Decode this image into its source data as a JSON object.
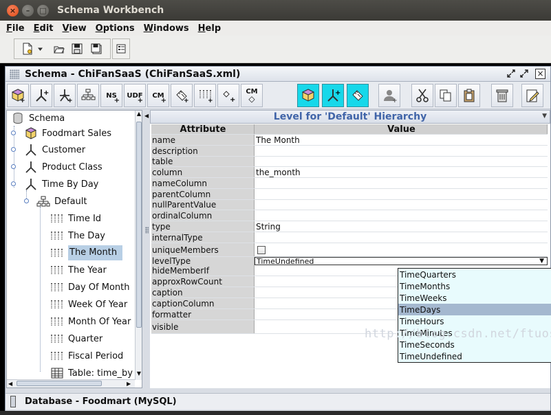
{
  "window": {
    "title": "Schema Workbench"
  },
  "menus": [
    "File",
    "Edit",
    "View",
    "Options",
    "Windows",
    "Help"
  ],
  "menu_mnemonics": [
    "F",
    "E",
    "V",
    "O",
    "W",
    "H"
  ],
  "frame": {
    "title": "Schema - ChiFanSaaS (ChiFanSaaS.xml)"
  },
  "toolbar": {
    "buttons": [
      {
        "icon": "cube-icon",
        "label": ""
      },
      {
        "icon": "dimension-icon",
        "label": ""
      },
      {
        "icon": "dimension-usage-icon",
        "label": ""
      },
      {
        "icon": "hierarchy-icon",
        "label": ""
      },
      {
        "icon": "named-set-icon",
        "label": "NS"
      },
      {
        "icon": "udf-icon",
        "label": "UDF"
      },
      {
        "icon": "calculated-member-icon",
        "label": "CM"
      },
      {
        "icon": "measure-icon",
        "label": ""
      },
      {
        "icon": "level-icon",
        "label": ""
      },
      {
        "icon": "property-icon",
        "label": ""
      },
      {
        "icon": "calculated-member-property-icon",
        "label": "CM"
      },
      {
        "icon": "virtual-cube-icon",
        "label": ""
      },
      {
        "icon": "virtual-dimension-icon",
        "label": ""
      },
      {
        "icon": "virtual-measure-icon",
        "label": ""
      },
      {
        "icon": "role-icon",
        "label": ""
      },
      {
        "icon": "cut-icon",
        "label": ""
      },
      {
        "icon": "copy-icon",
        "label": ""
      },
      {
        "icon": "paste-icon",
        "label": ""
      },
      {
        "icon": "delete-icon",
        "label": ""
      },
      {
        "icon": "edit-icon",
        "label": ""
      }
    ]
  },
  "tree": {
    "items": [
      {
        "label": "Schema",
        "icon": "schema-icon"
      },
      {
        "label": "Foodmart Sales",
        "icon": "cube-icon"
      },
      {
        "label": "Customer",
        "icon": "dimension-icon"
      },
      {
        "label": "Product Class",
        "icon": "dimension-icon"
      },
      {
        "label": "Time By Day",
        "icon": "dimension-icon"
      },
      {
        "label": "Default",
        "icon": "hierarchy-icon"
      },
      {
        "label": "Time Id",
        "icon": "level-icon"
      },
      {
        "label": "The Day",
        "icon": "level-icon"
      },
      {
        "label": "The Month",
        "icon": "level-icon",
        "selected": true
      },
      {
        "label": "The Year",
        "icon": "level-icon"
      },
      {
        "label": "Day Of Month",
        "icon": "level-icon"
      },
      {
        "label": "Week Of Year",
        "icon": "level-icon"
      },
      {
        "label": "Month Of Year",
        "icon": "level-icon"
      },
      {
        "label": "Quarter",
        "icon": "level-icon"
      },
      {
        "label": "Fiscal Period",
        "icon": "level-icon"
      },
      {
        "label": "Table: time_by",
        "icon": "table-icon"
      }
    ]
  },
  "panel": {
    "header": "Level for 'Default' Hierarchy",
    "col_attribute": "Attribute",
    "col_value": "Value",
    "rows": [
      {
        "attr": "name",
        "value": "The Month"
      },
      {
        "attr": "description",
        "value": ""
      },
      {
        "attr": "table",
        "value": ""
      },
      {
        "attr": "column",
        "value": "the_month"
      },
      {
        "attr": "nameColumn",
        "value": ""
      },
      {
        "attr": "parentColumn",
        "value": ""
      },
      {
        "attr": "nullParentValue",
        "value": ""
      },
      {
        "attr": "ordinalColumn",
        "value": ""
      },
      {
        "attr": "type",
        "value": "String"
      },
      {
        "attr": "internalType",
        "value": ""
      },
      {
        "attr": "uniqueMembers",
        "value": ""
      },
      {
        "attr": "levelType",
        "value": "TimeUndefined"
      },
      {
        "attr": "hideMemberIf",
        "value": ""
      },
      {
        "attr": "approxRowCount",
        "value": ""
      },
      {
        "attr": "caption",
        "value": ""
      },
      {
        "attr": "captionColumn",
        "value": ""
      },
      {
        "attr": "formatter",
        "value": ""
      },
      {
        "attr": "visible",
        "value": ""
      }
    ],
    "uniqueMembers_checked": false,
    "levelType_options": [
      "TimeQuarters",
      "TimeMonths",
      "TimeWeeks",
      "TimeDays",
      "TimeHours",
      "TimeMinutes",
      "TimeSeconds",
      "TimeUndefined"
    ],
    "levelType_highlighted": "TimeDays"
  },
  "status": {
    "text": "Database - Foodmart (MySQL)"
  },
  "watermark": "http://blog.csdn.net/ftuos",
  "colors": {
    "selected_button": "#17d8ea",
    "tree_selection": "#b8cfe5",
    "list_highlight": "#a4b8cf",
    "header_text": "#4064a8",
    "close_button": "#df4b16"
  }
}
